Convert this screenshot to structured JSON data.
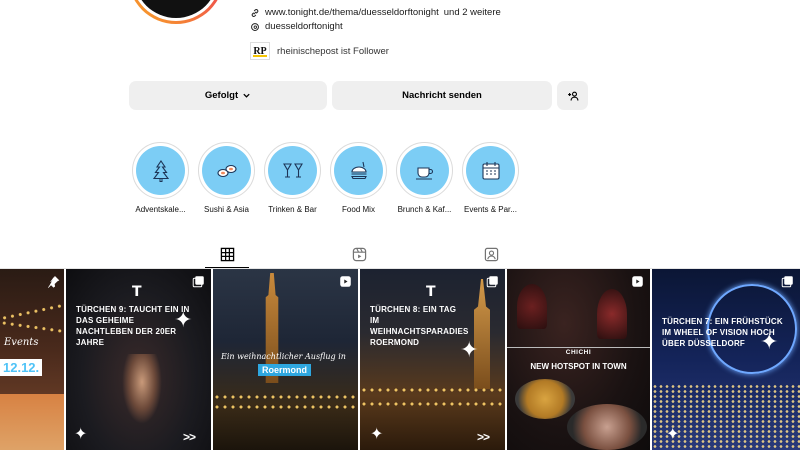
{
  "profile": {
    "links": [
      {
        "url": "www.tonight.de/thema/duesseldorftonight",
        "suffix": "und 2 weitere"
      },
      {
        "url": "duesseldorftonight",
        "suffix": ""
      }
    ],
    "followed_by": "rheinischepost ist Follower",
    "followed_by_logo": "RP"
  },
  "actions": {
    "follow_label": "Gefolgt",
    "message_label": "Nachricht senden"
  },
  "highlights": [
    {
      "label": "Adventskale...",
      "icon": "christmas-tree-icon"
    },
    {
      "label": "Sushi & Asia",
      "icon": "sushi-icon"
    },
    {
      "label": "Trinken & Bar",
      "icon": "cocktail-glasses-icon"
    },
    {
      "label": "Food Mix",
      "icon": "burger-icon"
    },
    {
      "label": "Brunch & Kaf...",
      "icon": "coffee-cup-icon"
    },
    {
      "label": "Events & Par...",
      "icon": "calendar-icon"
    }
  ],
  "tabs": [
    {
      "name": "posts",
      "icon": "grid-icon",
      "active": true
    },
    {
      "name": "reels",
      "icon": "reels-icon",
      "active": false
    },
    {
      "name": "tagged",
      "icon": "tagged-icon",
      "active": false
    }
  ],
  "posts": [
    {
      "type": "pinned",
      "overlay_text": "Events",
      "date_text": "12.12.",
      "badge": "pin-icon"
    },
    {
      "type": "reel",
      "logo": "T",
      "title": "TÜRCHEN 9: TAUCHT EIN IN DAS GEHEIME NACHTLEBEN DER 20ER JAHRE",
      "arrows": ">>",
      "badge": "carousel-icon"
    },
    {
      "type": "reel",
      "subtitle": "Ein weihnachtlicher Ausflug in",
      "title": "Roermond",
      "badge": "reel-icon"
    },
    {
      "type": "carousel",
      "logo": "T",
      "title": "TÜRCHEN 8: EIN TAG IM WEIHNACHTSPARADIES ROERMOND",
      "arrows": ">>",
      "badge": "carousel-icon"
    },
    {
      "type": "reel",
      "label": "CHICHI",
      "title": "NEW HOTSPOT IN TOWN",
      "badge": "reel-icon"
    },
    {
      "type": "carousel",
      "logo": "T",
      "title": "TÜRCHEN 7: EIN FRÜHSTÜCK IM WHEEL OF VISION HOCH ÜBER DÜSSELDORF",
      "arrows": ">>",
      "badge": "carousel-icon"
    }
  ],
  "colors": {
    "highlight_bg": "#7ccdf5",
    "button_bg": "#efefef",
    "accent_date": "#4fc3f7"
  }
}
